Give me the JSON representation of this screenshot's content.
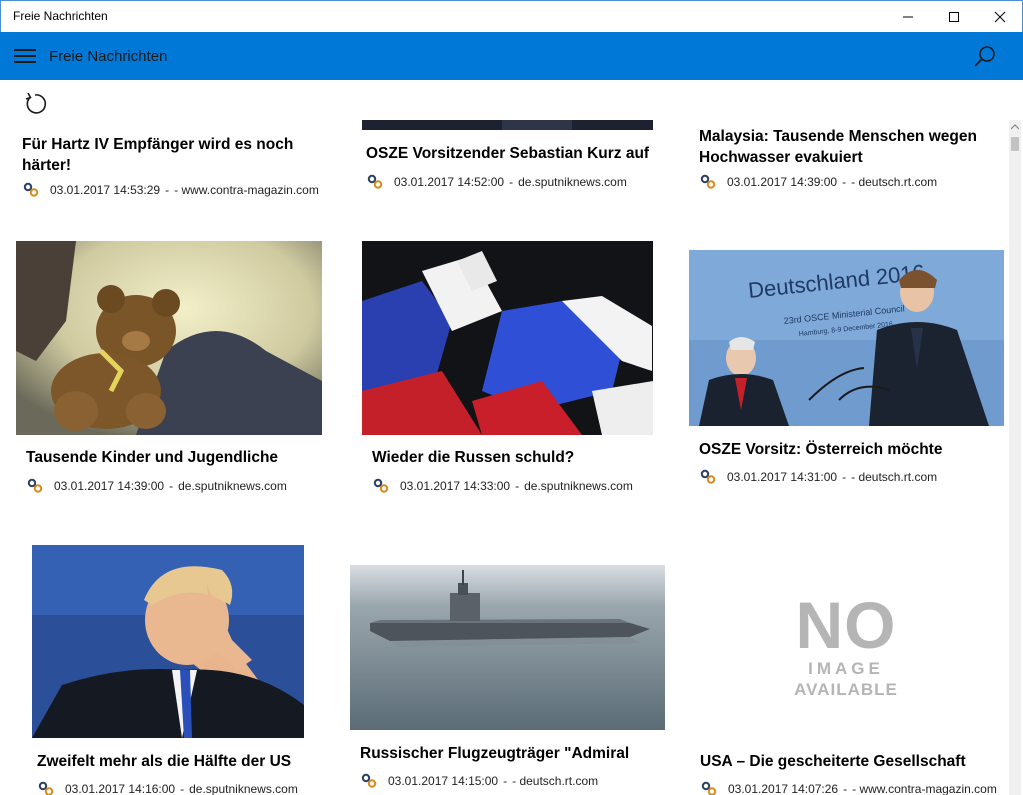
{
  "window": {
    "title": "Freie Nachrichten",
    "minimize_icon": "minimize-icon",
    "maximize_icon": "maximize-icon",
    "close_icon": "close-icon"
  },
  "appbar": {
    "title": "Freie Nachrichten",
    "menu_icon": "hamburger-icon",
    "search_icon": "search-icon",
    "accent": "#0078d7"
  },
  "content": {
    "refresh_icon": "refresh-icon"
  },
  "no_image": {
    "line1": "NO",
    "line2": "IMAGE",
    "line3": "AVAILABLE"
  },
  "articles": [
    {
      "title": "Für Hartz IV Empfänger wird es noch",
      "title2": "härter!",
      "date": "03.01.2017 14:53:29",
      "separator": "-",
      "source": "- www.contra-magazin.com"
    },
    {
      "title": "OSZE Vorsitzender Sebastian Kurz auf",
      "date": "03.01.2017 14:52:00",
      "separator": "-",
      "source": "de.sputniknews.com"
    },
    {
      "title": "Malaysia: Tausende Menschen wegen",
      "title2": "Hochwasser evakuiert",
      "date": "03.01.2017 14:39:00",
      "separator": "-",
      "source": "- deutsch.rt.com"
    },
    {
      "title": "Tausende Kinder und Jugendliche",
      "date": "03.01.2017 14:39:00",
      "separator": "-",
      "source": "de.sputniknews.com",
      "image": "teddy-bear"
    },
    {
      "title": "Wieder die Russen schuld?",
      "date": "03.01.2017 14:33:00",
      "separator": "-",
      "source": "de.sputniknews.com",
      "image": "gloves"
    },
    {
      "title": "OSZE Vorsitz: Österreich möchte",
      "date": "03.01.2017 14:31:00",
      "separator": "-",
      "source": "- deutsch.rt.com",
      "image": "osce-conference"
    },
    {
      "title": "Zweifelt mehr als die Hälfte der US",
      "date": "03.01.2017 14:16:00",
      "separator": "-",
      "source": "de.sputniknews.com",
      "image": "politician"
    },
    {
      "title": "Russischer Flugzeugträger \"Admiral",
      "date": "03.01.2017 14:15:00",
      "separator": "-",
      "source": "- deutsch.rt.com",
      "image": "aircraft-carrier"
    },
    {
      "title": "USA – Die gescheiterte Gesellschaft",
      "date": "03.01.2017 14:07:26",
      "separator": "-",
      "source": "- www.contra-magazin.com",
      "image": "no-image"
    }
  ],
  "image_texts": {
    "deutschland": "Deutschland 2016",
    "osce": "23rd OSCE Ministerial Council",
    "hamburg": "Hamburg, 8-9 December 2016"
  }
}
